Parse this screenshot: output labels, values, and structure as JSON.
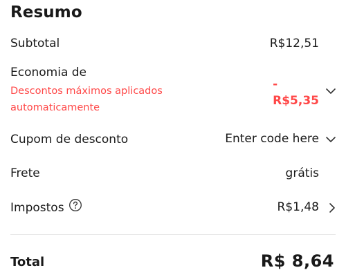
{
  "summary": {
    "title": "Resumo",
    "subtotal": {
      "label": "Subtotal",
      "value": "R$12,51"
    },
    "savings": {
      "label": "Economia de",
      "note": "Descontos máximos aplicados automaticamente",
      "value_sign": "-",
      "value": "R$5,35",
      "expand_icon": "chevron-down-icon"
    },
    "coupon": {
      "label": "Cupom de desconto",
      "placeholder": "Enter code here",
      "expand_icon": "chevron-down-icon"
    },
    "shipping": {
      "label": "Frete",
      "value": "grátis"
    },
    "taxes": {
      "label": "Impostos",
      "help_icon": "question-circle-icon",
      "value": "R$1,48",
      "detail_icon": "chevron-right-icon"
    },
    "total": {
      "label": "Total",
      "value": "R$ 8,64"
    }
  },
  "colors": {
    "text": "#191919",
    "accent_red": "#ff4747",
    "divider": "#e8e8e8",
    "icon": "#333333"
  }
}
